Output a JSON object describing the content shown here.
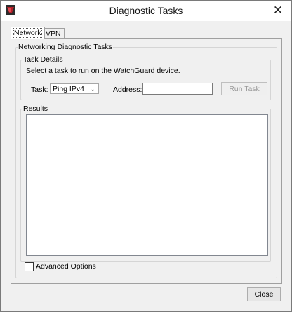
{
  "window": {
    "title": "Diagnostic Tasks",
    "close_glyph": "✕"
  },
  "tabs": [
    {
      "label": "Network",
      "active": true
    },
    {
      "label": "VPN",
      "active": false
    }
  ],
  "network": {
    "group_title": "Networking Diagnostic Tasks",
    "task_details": {
      "title": "Task Details",
      "description": "Select a task to run on the WatchGuard device.",
      "task_label": "Task:",
      "task_value": "Ping IPv4",
      "address_label": "Address:",
      "address_value": "",
      "run_button": "Run Task",
      "run_enabled": false
    },
    "results": {
      "title": "Results",
      "content": ""
    },
    "advanced_options": {
      "label": "Advanced Options",
      "checked": false
    }
  },
  "footer": {
    "close_button": "Close"
  },
  "icons": {
    "app": "watchguard-app-icon",
    "close": "close-icon",
    "dropdown": "chevron-down-icon"
  },
  "colors": {
    "brand_red": "#b3202a",
    "window_bg": "#f0f0f0"
  }
}
